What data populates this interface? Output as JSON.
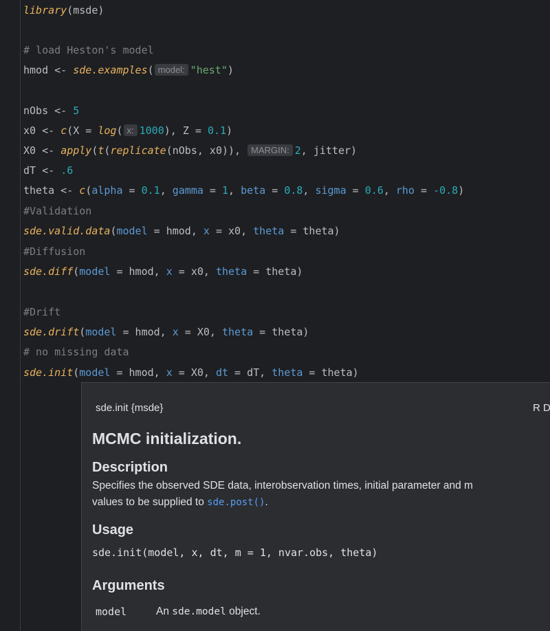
{
  "code": {
    "l1": {
      "fn": "library",
      "rest": "(msde)"
    },
    "l3": {
      "comment": "# load Heston's model"
    },
    "l4": {
      "pre": "hmod <- ",
      "fn": "sde.examples",
      "open": "(",
      "hint": "model:",
      "str": "\"hest\"",
      "close": ")"
    },
    "l6": {
      "pre": "nObs <- ",
      "num": "5"
    },
    "l7": {
      "pre": "x0 <- ",
      "fn_c": "c",
      "a": "(X = ",
      "fn_log": "log",
      "b": "(",
      "hint": "x:",
      "num": "1000",
      "c": "), Z = ",
      "num2": "0.1",
      "d": ")"
    },
    "l8": {
      "pre": "X0 <- ",
      "fn_apply": "apply",
      "a": "(",
      "fn_t": "t",
      "b": "(",
      "fn_rep": "replicate",
      "c": "(nObs, x0)), ",
      "hint": "MARGIN:",
      "num": "2",
      "d": ", jitter)"
    },
    "l9": {
      "pre": "dT <- ",
      "num": ".6"
    },
    "l10": {
      "pre": "theta <- ",
      "fn": "c",
      "open": "(",
      "p1": "alpha",
      "e1": " = ",
      "v1": "0.1",
      "s1": ", ",
      "p2": "gamma",
      "e2": " = ",
      "v2": "1",
      "s2": ", ",
      "p3": "beta",
      "e3": " = ",
      "v3": "0.8",
      "s3": ", ",
      "p4": "sigma",
      "e4": " = ",
      "v4": "0.6",
      "s4": ", ",
      "p5": "rho",
      "e5": " = ",
      "v5": "-0.8",
      "close": ")"
    },
    "l11": {
      "comment": "#Validation"
    },
    "l12": {
      "fn": "sde.valid.data",
      "open": "(",
      "p1": "model",
      "a": " = hmod, ",
      "p2": "x",
      "b": " = x0, ",
      "p3": "theta",
      "c": " = theta)"
    },
    "l13": {
      "comment": "#Diffusion"
    },
    "l14": {
      "fn": "sde.diff",
      "open": "(",
      "p1": "model",
      "a": " = hmod, ",
      "p2": "x",
      "b": " = x0, ",
      "p3": "theta",
      "c": " = theta)"
    },
    "l16": {
      "comment": "#Drift"
    },
    "l17": {
      "fn": "sde.drift",
      "open": "(",
      "p1": "model",
      "a": " = hmod, ",
      "p2": "x",
      "b": " = X0, ",
      "p3": "theta",
      "c": " = theta)"
    },
    "l18": {
      "comment": "# no missing data"
    },
    "l19": {
      "fn": "sde.init",
      "open": "(",
      "p1": "model",
      "a": " = hmod, ",
      "p2": "x",
      "b": " = X0, ",
      "p3": "dt",
      "c": " = dT, ",
      "p4": "theta",
      "d": " = theta)"
    }
  },
  "doc_popup": {
    "header": "sde.init {msde}",
    "header_right": "R D",
    "title": "MCMC initialization.",
    "description_heading": "Description",
    "description_line1": "Specifies the observed SDE data, interobservation times, initial parameter and m",
    "description_line2_pre": "values to be supplied to ",
    "description_link": "sde.post()",
    "description_line2_post": ".",
    "usage_heading": "Usage",
    "usage_code": "sde.init(model, x, dt, m = 1, nvar.obs, theta)",
    "arguments_heading": "Arguments",
    "arg_name": "model",
    "arg_desc_pre": "An ",
    "arg_desc_code": "sde.model",
    "arg_desc_post": " object."
  },
  "colors": {
    "background": "#1e1f22",
    "function": "#e8b35e",
    "comment": "#7a7e85",
    "string": "#6aab73",
    "number": "#2aacb8",
    "parameter": "#5b9bd5",
    "popup_bg": "#2b2d30",
    "link": "#589df6"
  }
}
